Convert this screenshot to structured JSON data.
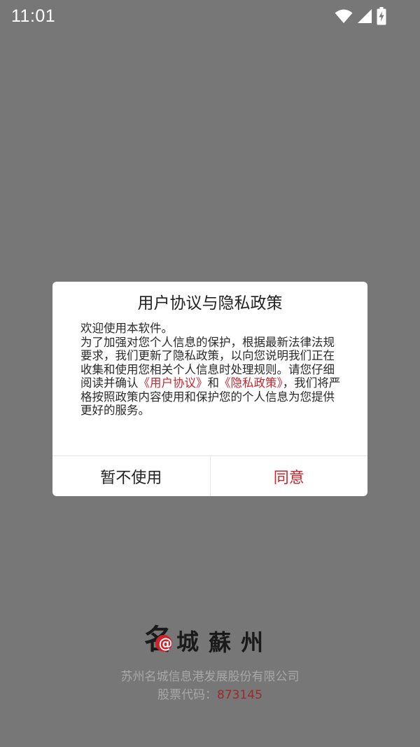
{
  "status_bar": {
    "time": "11:01",
    "icons": [
      "wifi-icon",
      "signal-icon",
      "battery-charging-icon"
    ]
  },
  "dialog": {
    "title": "用户协议与隐私政策",
    "body": {
      "line1": "欢迎使用本软件。",
      "intro": "为了加强对您个人信息的保护，根据最新法律法规要求，我们更新了隐私政策，以向您说明我们正在收集和使用您相关个人信息时处理规则。请您仔细阅读并确认",
      "user_agreement_link": "《用户协议》",
      "and_text": "和",
      "privacy_policy_link": "《隐私政策》",
      "outro": "，我们将严格按照政策内容使用和保护您的个人信息为您提供更好的服务。"
    },
    "buttons": {
      "decline": "暂不使用",
      "agree": "同意"
    }
  },
  "footer": {
    "logo_text": "名城蘇州",
    "company_name": "苏州名城信息港发展股份有限公司",
    "stock_label": "股票代码：",
    "stock_code": "873145"
  },
  "colors": {
    "overlay_background": "#777777",
    "accent": "#c8252d",
    "dialog_background": "#ffffff"
  }
}
